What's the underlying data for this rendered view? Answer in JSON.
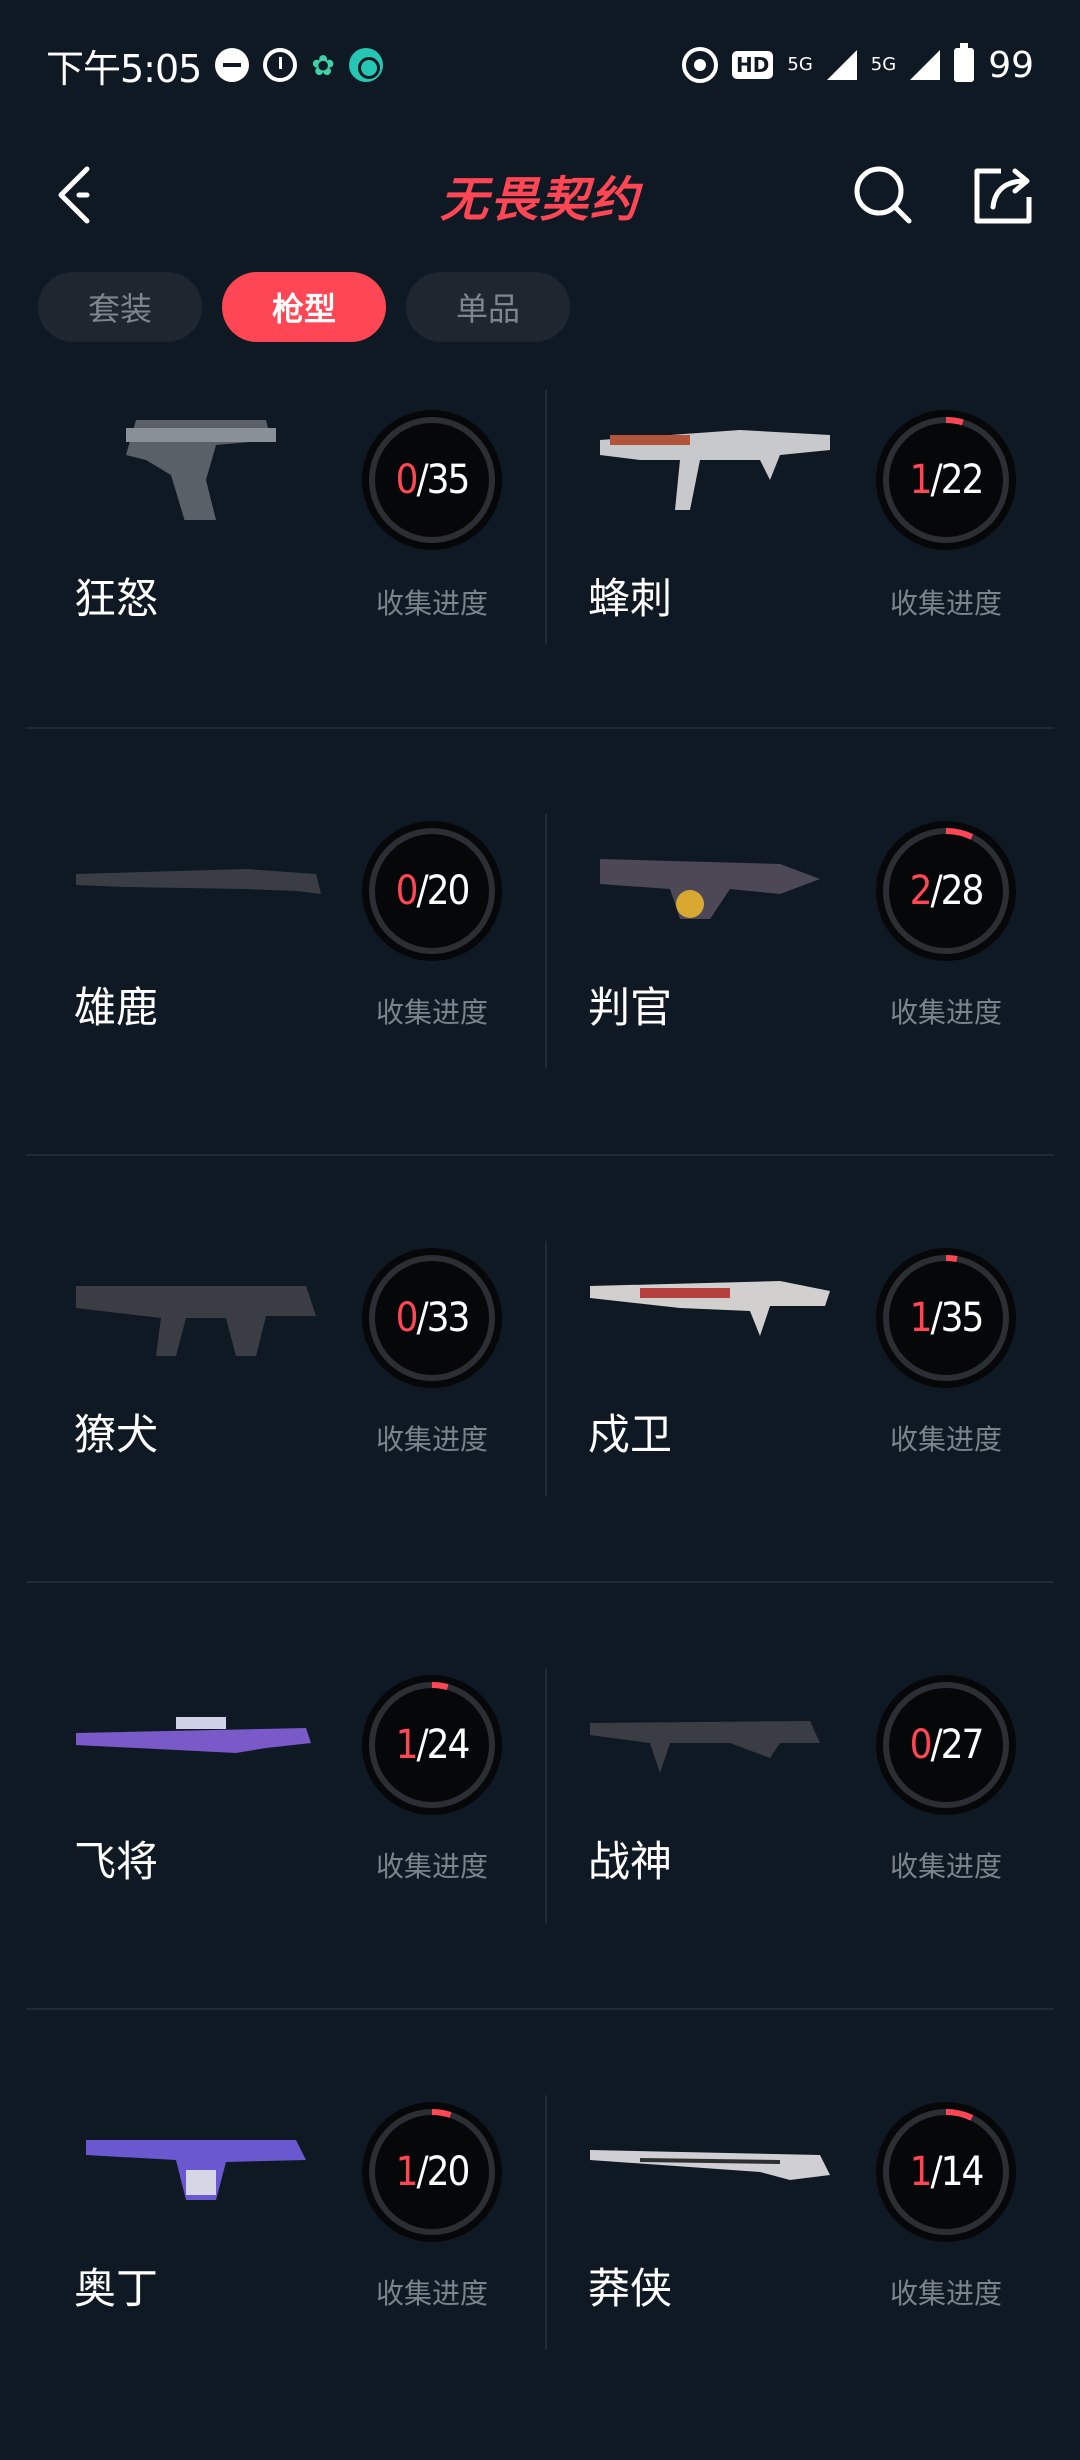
{
  "status_bar": {
    "time": "下午5:05",
    "hd_badge": "HD",
    "net_a": "5G",
    "net_b": "5G",
    "battery": "99"
  },
  "header": {
    "title": "无畏契约"
  },
  "tabs": [
    {
      "label": "套装",
      "active": false
    },
    {
      "label": "枪型",
      "active": true
    },
    {
      "label": "单品",
      "active": false
    }
  ],
  "progress_caption": "收集进度",
  "weapons": [
    {
      "name": "狂怒",
      "got": "0",
      "total": "/35",
      "fraction": 0.0
    },
    {
      "name": "蜂刺",
      "got": "1",
      "total": "/22",
      "fraction": 0.045
    },
    {
      "name": "雄鹿",
      "got": "0",
      "total": "/20",
      "fraction": 0.0
    },
    {
      "name": "判官",
      "got": "2",
      "total": "/28",
      "fraction": 0.071
    },
    {
      "name": "獠犬",
      "got": "0",
      "total": "/33",
      "fraction": 0.0
    },
    {
      "name": "戍卫",
      "got": "1",
      "total": "/35",
      "fraction": 0.029
    },
    {
      "name": "飞将",
      "got": "1",
      "total": "/24",
      "fraction": 0.042
    },
    {
      "name": "战神",
      "got": "0",
      "total": "/27",
      "fraction": 0.0
    },
    {
      "name": "奥丁",
      "got": "1",
      "total": "/20",
      "fraction": 0.05
    },
    {
      "name": "莽侠",
      "got": "1",
      "total": "/14",
      "fraction": 0.071
    }
  ],
  "colors": {
    "accent": "#ff4655",
    "bg": "#0f1923",
    "tab_bg": "#1e2730"
  }
}
